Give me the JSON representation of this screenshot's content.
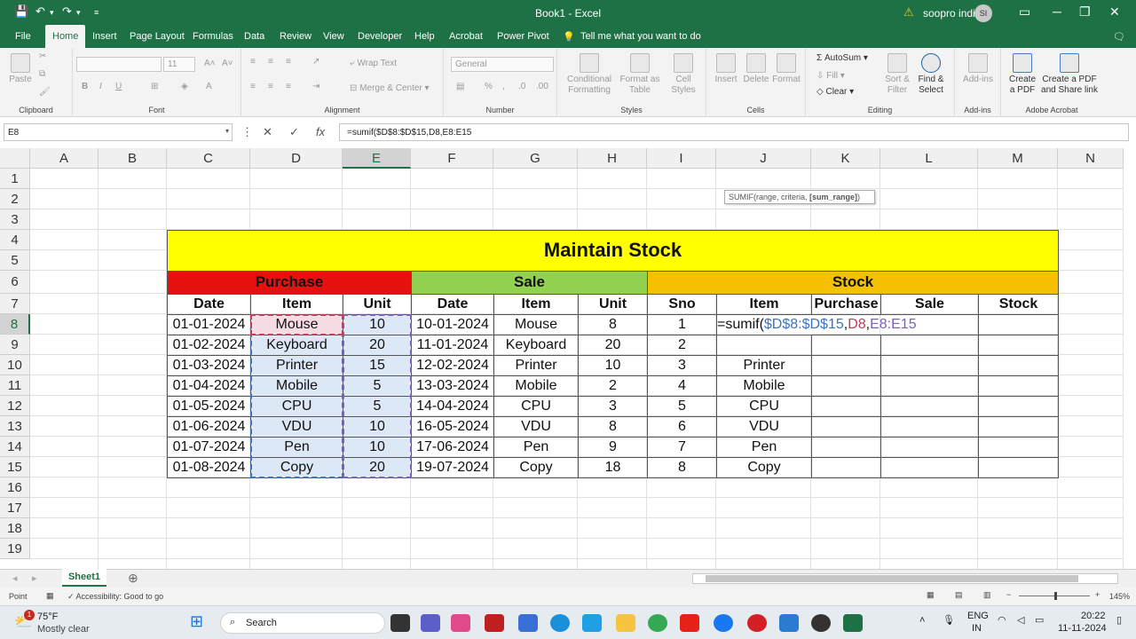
{
  "window": {
    "title": "Book1  -  Excel",
    "user": "soopro india",
    "avatar": "SI"
  },
  "menu": [
    "File",
    "Home",
    "Insert",
    "Page Layout",
    "Formulas",
    "Data",
    "Review",
    "View",
    "Developer",
    "Help",
    "Acrobat",
    "Power Pivot"
  ],
  "tell_me": "Tell me what you want to do",
  "ribbon": {
    "paste": "Paste",
    "clipboard": "Clipboard",
    "font_size": "11",
    "font": "Font",
    "wrap_text": "Wrap Text",
    "merge_center": "Merge & Center",
    "alignment": "Alignment",
    "number_format": "General",
    "number": "Number",
    "conditional_formatting": "Conditional Formatting",
    "format_as_table": "Format as Table",
    "cell_styles": "Cell Styles",
    "styles": "Styles",
    "insert": "Insert",
    "delete": "Delete",
    "format": "Format",
    "cells": "Cells",
    "autosum": "AutoSum",
    "fill": "Fill",
    "clear": "Clear",
    "sort_filter": "Sort & Filter",
    "find_select": "Find & Select",
    "editing": "Editing",
    "addins_btn": "Add-ins",
    "addins": "Add-ins",
    "create_pdf": "Create a PDF",
    "create_pdf_share": "Create a PDF and Share link",
    "adobe": "Adobe Acrobat"
  },
  "formula_bar": {
    "name_box": "E8",
    "formula": "=sumif($D$8:$D$15,D8,E8:E15",
    "cancel": "✕",
    "enter": "✓",
    "fx": "fx"
  },
  "columns": [
    "A",
    "B",
    "C",
    "D",
    "E",
    "F",
    "G",
    "H",
    "I",
    "J",
    "K",
    "L",
    "M",
    "N"
  ],
  "rows": [
    "1",
    "2",
    "3",
    "4",
    "5",
    "6",
    "7",
    "8",
    "9",
    "10",
    "11",
    "12",
    "13",
    "14",
    "15",
    "16",
    "17",
    "18",
    "19"
  ],
  "sheet": {
    "title": "Maintain Stock",
    "section_purchase": "Purchase",
    "section_sale": "Sale",
    "section_stock": "Stock",
    "headers": [
      "Date",
      "Item",
      "Unit",
      "Date",
      "Item",
      "Unit",
      "Sno",
      "Item",
      "Purchase",
      "Sale",
      "Stock"
    ],
    "purchase": [
      [
        "01-01-2024",
        "Mouse",
        "10"
      ],
      [
        "01-02-2024",
        "Keyboard",
        "20"
      ],
      [
        "01-03-2024",
        "Printer",
        "15"
      ],
      [
        "01-04-2024",
        "Mobile",
        "5"
      ],
      [
        "01-05-2024",
        "CPU",
        "5"
      ],
      [
        "01-06-2024",
        "VDU",
        "10"
      ],
      [
        "01-07-2024",
        "Pen",
        "10"
      ],
      [
        "01-08-2024",
        "Copy",
        "20"
      ]
    ],
    "sale": [
      [
        "10-01-2024",
        "Mouse",
        "8"
      ],
      [
        "11-01-2024",
        "Keyboard",
        "20"
      ],
      [
        "12-02-2024",
        "Printer",
        "10"
      ],
      [
        "13-03-2024",
        "Mobile",
        "2"
      ],
      [
        "14-04-2024",
        "CPU",
        "3"
      ],
      [
        "16-05-2024",
        "VDU",
        "8"
      ],
      [
        "17-06-2024",
        "Pen",
        "9"
      ],
      [
        "19-07-2024",
        "Copy",
        "18"
      ]
    ],
    "stock": [
      [
        "1",
        ""
      ],
      [
        "2",
        ""
      ],
      [
        "3",
        "Printer"
      ],
      [
        "4",
        "Mobile"
      ],
      [
        "5",
        "CPU"
      ],
      [
        "6",
        "VDU"
      ],
      [
        "7",
        "Pen"
      ],
      [
        "8",
        "Copy"
      ]
    ],
    "editing_formula": {
      "prefix": "=sumif(",
      "range": "$D$8:$D$15",
      "sep1": ",",
      "criteria": "D8",
      "sep2": ",",
      "sum_range": "E8:E15"
    },
    "tooltip": {
      "text": "SUMIF(range, criteria, ",
      "bold": "[sum_range]",
      "close": ")"
    }
  },
  "sheet_tab": "Sheet1",
  "status": {
    "mode": "Point",
    "accessibility": "Accessibility: Good to go",
    "zoom": "145%"
  },
  "taskbar": {
    "temp": "75°F",
    "weather": "Mostly clear",
    "search": "Search",
    "lang1": "ENG",
    "lang2": "IN",
    "time": "20:22",
    "date": "11-11-2024",
    "badge": "1"
  },
  "colors": {
    "green": "#1e7145",
    "yellow": "#ffff00",
    "red": "#e8100f",
    "sale_green": "#92d050",
    "stock_orange": "#f5c000",
    "sel_range": "#dde8f6",
    "sel_criteria": "#f5dbe3"
  }
}
